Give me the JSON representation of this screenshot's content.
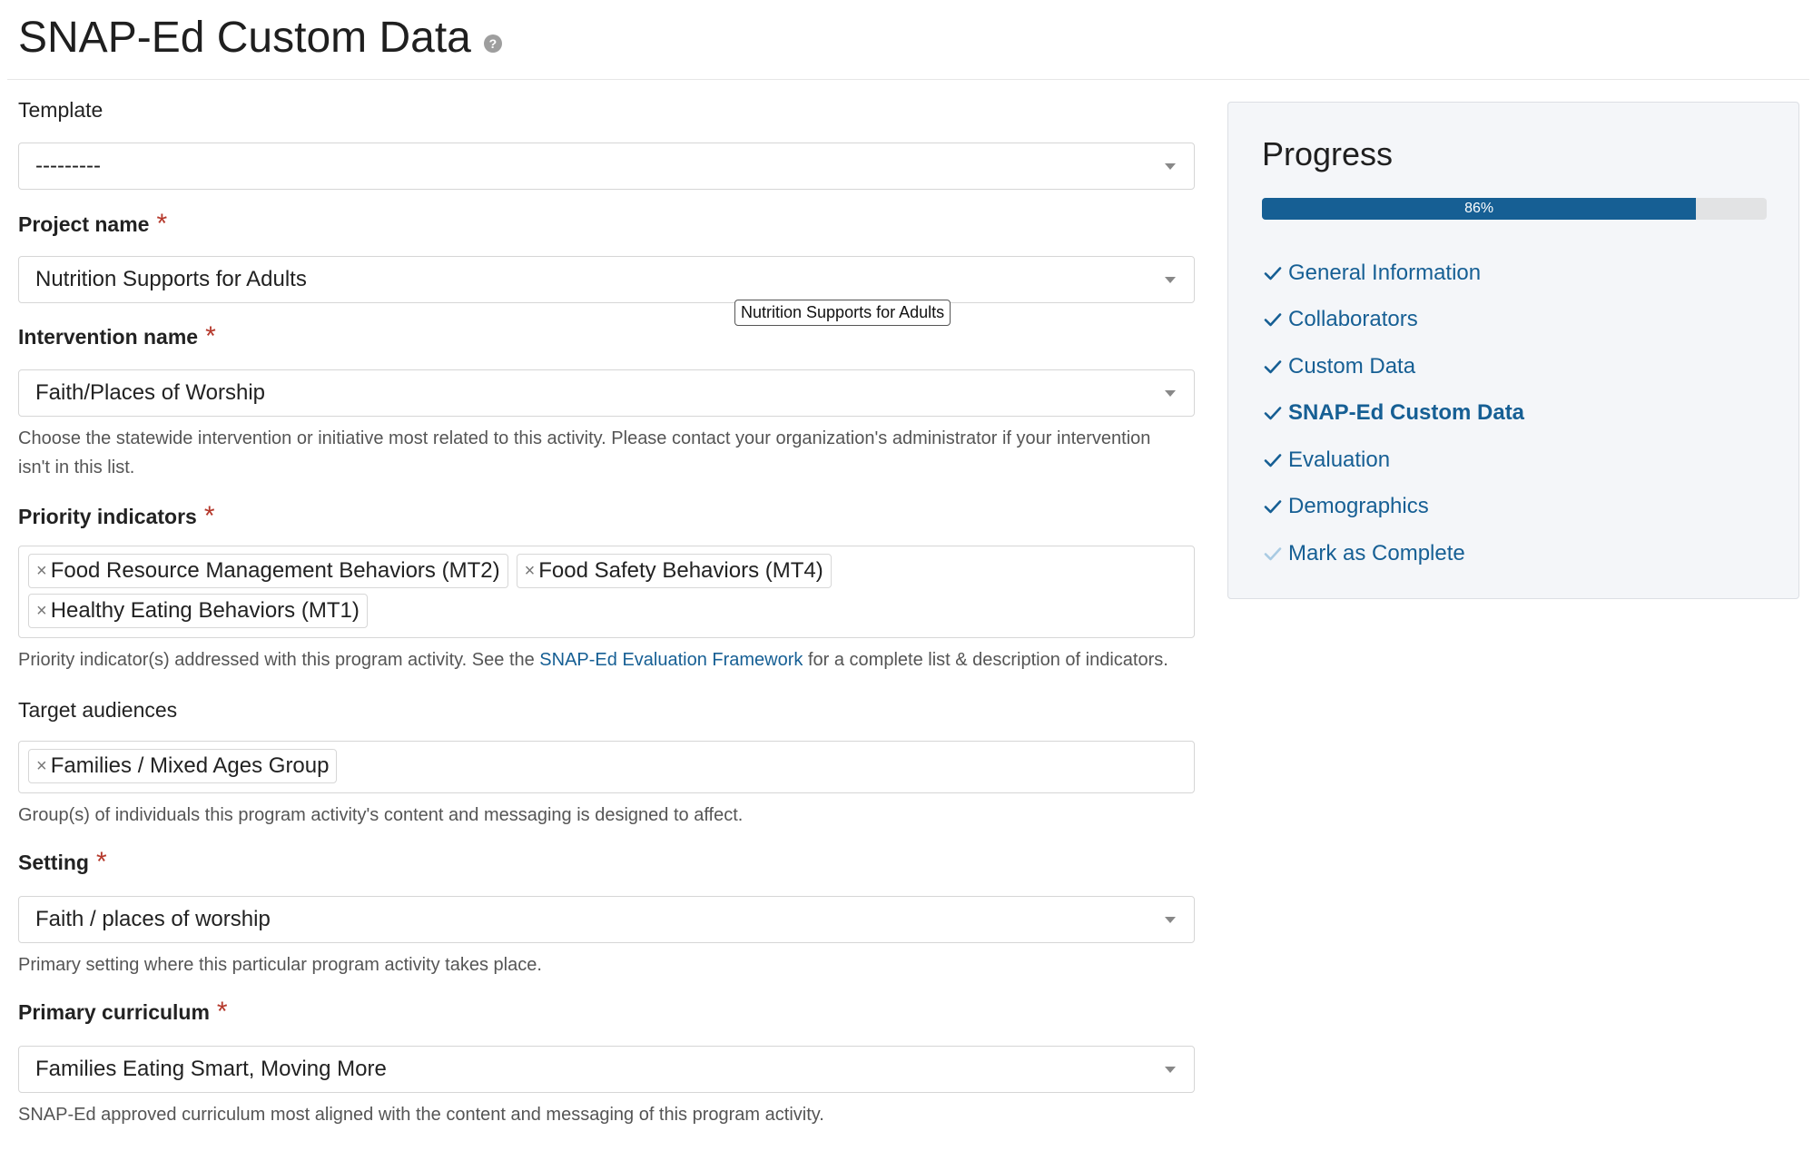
{
  "header": {
    "title": "SNAP-Ed Custom Data",
    "help_glyph": "?"
  },
  "form": {
    "template": {
      "label": "Template",
      "value": "---------"
    },
    "project": {
      "label": "Project name",
      "required_mark": "*",
      "value": "Nutrition Supports for Adults",
      "tooltip": "Nutrition Supports for Adults"
    },
    "intervention": {
      "label": "Intervention name",
      "required_mark": "*",
      "value": "Faith/Places of Worship",
      "help": "Choose the statewide intervention or initiative most related to this activity. Please contact your organization's administrator if your intervention isn't in this list."
    },
    "priority": {
      "label": "Priority indicators",
      "required_mark": "*",
      "tags": [
        "Food Resource Management Behaviors (MT2)",
        "Food Safety Behaviors (MT4)",
        "Healthy Eating Behaviors (MT1)"
      ],
      "help_before": "Priority indicator(s) addressed with this program activity. See the ",
      "help_link": "SNAP-Ed Evaluation Framework",
      "help_after": " for a complete list & description of indicators."
    },
    "audiences": {
      "label": "Target audiences",
      "tags": [
        "Families / Mixed Ages Group"
      ],
      "help": "Group(s) of individuals this program activity's content and messaging is designed to affect."
    },
    "setting": {
      "label": "Setting",
      "required_mark": "*",
      "value": "Faith / places of worship",
      "help": "Primary setting where this particular program activity takes place."
    },
    "curriculum": {
      "label": "Primary curriculum",
      "required_mark": "*",
      "value": "Families Eating Smart, Moving More",
      "help": "SNAP-Ed approved curriculum most aligned with the content and messaging of this program activity."
    },
    "tag_remove_glyph": "×"
  },
  "progress": {
    "title": "Progress",
    "percent_label": "86%",
    "fraction": 0.86,
    "steps": [
      {
        "label": "General Information",
        "done": true
      },
      {
        "label": "Collaborators",
        "done": true
      },
      {
        "label": "Custom Data",
        "done": true
      },
      {
        "label": "SNAP-Ed Custom Data",
        "done": true,
        "current": true
      },
      {
        "label": "Evaluation",
        "done": true
      },
      {
        "label": "Demographics",
        "done": true
      },
      {
        "label": "Mark as Complete",
        "done": false
      }
    ]
  },
  "colors": {
    "accent": "#165f94",
    "required": "#b5382b",
    "check_done": "#165f94",
    "check_pending": "#a9cbe3"
  }
}
